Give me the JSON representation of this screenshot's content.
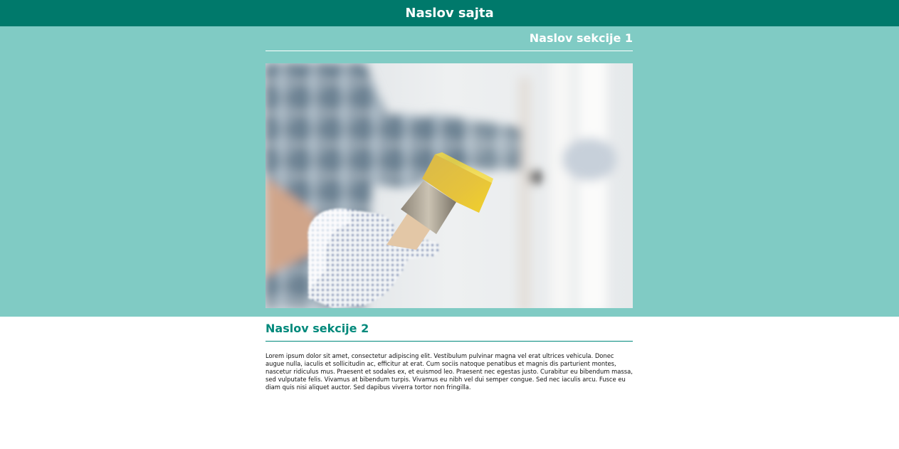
{
  "header": {
    "site_title": "Naslov sajta"
  },
  "section_1": {
    "heading": "Naslov sekcije 1",
    "image": "hand-holding-paintbrush-photo"
  },
  "section_2": {
    "heading": "Naslov sekcije 2",
    "body": "Lorem ipsum dolor sit amet, consectetur adipiscing elit. Vestibulum pulvinar magna vel erat ultrices vehicula. Donec augue nulla, iaculis et sollicitudin ac, efficitur at erat. Cum sociis natoque penatibus et magnis dis parturient montes, nascetur ridiculus mus. Praesent et sodales ex, et euismod leo. Praesent nec egestas justo. Curabitur eu bibendum massa, sed vulputate felis. Vivamus at bibendum turpis. Vivamus eu nibh vel dui semper congue. Sed nec iaculis arcu. Fusce eu diam quis nisi aliquet auctor. Sed dapibus viverra tortor non fringilla."
  },
  "colors": {
    "header_bg": "#00796b",
    "section_1_bg": "#80cbc4",
    "section_2_accent": "#00897b"
  }
}
